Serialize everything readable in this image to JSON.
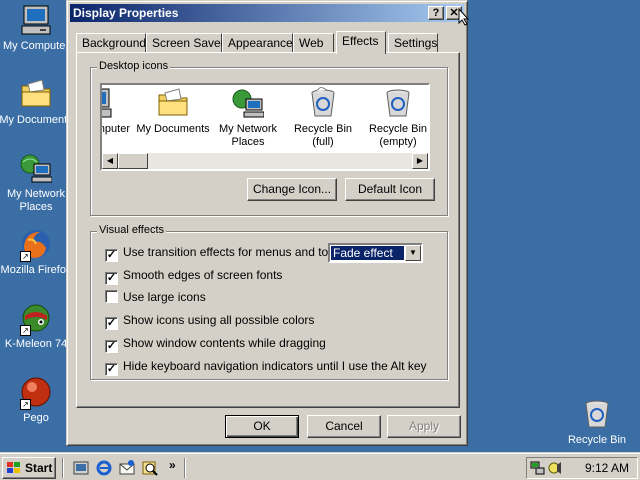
{
  "desktop": {
    "icons": [
      {
        "label": "My Computer"
      },
      {
        "label": "My Documents"
      },
      {
        "label_line1": "My Network",
        "label_line2": "Places"
      },
      {
        "label": "Mozilla Firefox"
      },
      {
        "label": "K-Meleon 74"
      },
      {
        "label": "Pego"
      },
      {
        "label": "Recycle Bin"
      }
    ]
  },
  "dialog": {
    "title": "Display Properties",
    "help_glyph": "?",
    "close_glyph": "✕",
    "tabs": [
      {
        "label": "Background"
      },
      {
        "label": "Screen Saver"
      },
      {
        "label": "Appearance"
      },
      {
        "label": "Web"
      },
      {
        "label": "Effects",
        "active": true
      },
      {
        "label": "Settings"
      }
    ],
    "desktop_icons_group": {
      "title": "Desktop icons",
      "items": [
        {
          "line1": "My Computer",
          "line2": ""
        },
        {
          "line1": "My Documents",
          "line2": ""
        },
        {
          "line1": "My Network",
          "line2": "Places"
        },
        {
          "line1": "Recycle Bin",
          "line2": "(full)"
        },
        {
          "line1": "Recycle Bin",
          "line2": "(empty)"
        }
      ],
      "change_icon_button": "Change Icon...",
      "default_icon_button": "Default Icon"
    },
    "visual_effects_group": {
      "title": "Visual effects",
      "options": [
        {
          "label": "Use transition effects for menus and tooltips",
          "checked": true
        },
        {
          "label": "Smooth edges of screen fonts",
          "checked": true
        },
        {
          "label": "Use large icons",
          "checked": false
        },
        {
          "label": "Show icons using all possible colors",
          "checked": true
        },
        {
          "label": "Show window contents while dragging",
          "checked": true
        },
        {
          "label": "Hide keyboard navigation indicators until I use the Alt key",
          "checked": true
        }
      ],
      "transition_select": {
        "value": "Fade effect"
      }
    },
    "buttons": {
      "ok": "OK",
      "cancel": "Cancel",
      "apply": "Apply"
    }
  },
  "taskbar": {
    "start_label": "Start",
    "quick_launch_more": "»",
    "clock": "9:12 AM"
  },
  "colors": {
    "desktop": "#3a6ea5",
    "title_active_start": "#0a246a",
    "title_active_end": "#a6caf0",
    "face": "#d4d0c8"
  }
}
